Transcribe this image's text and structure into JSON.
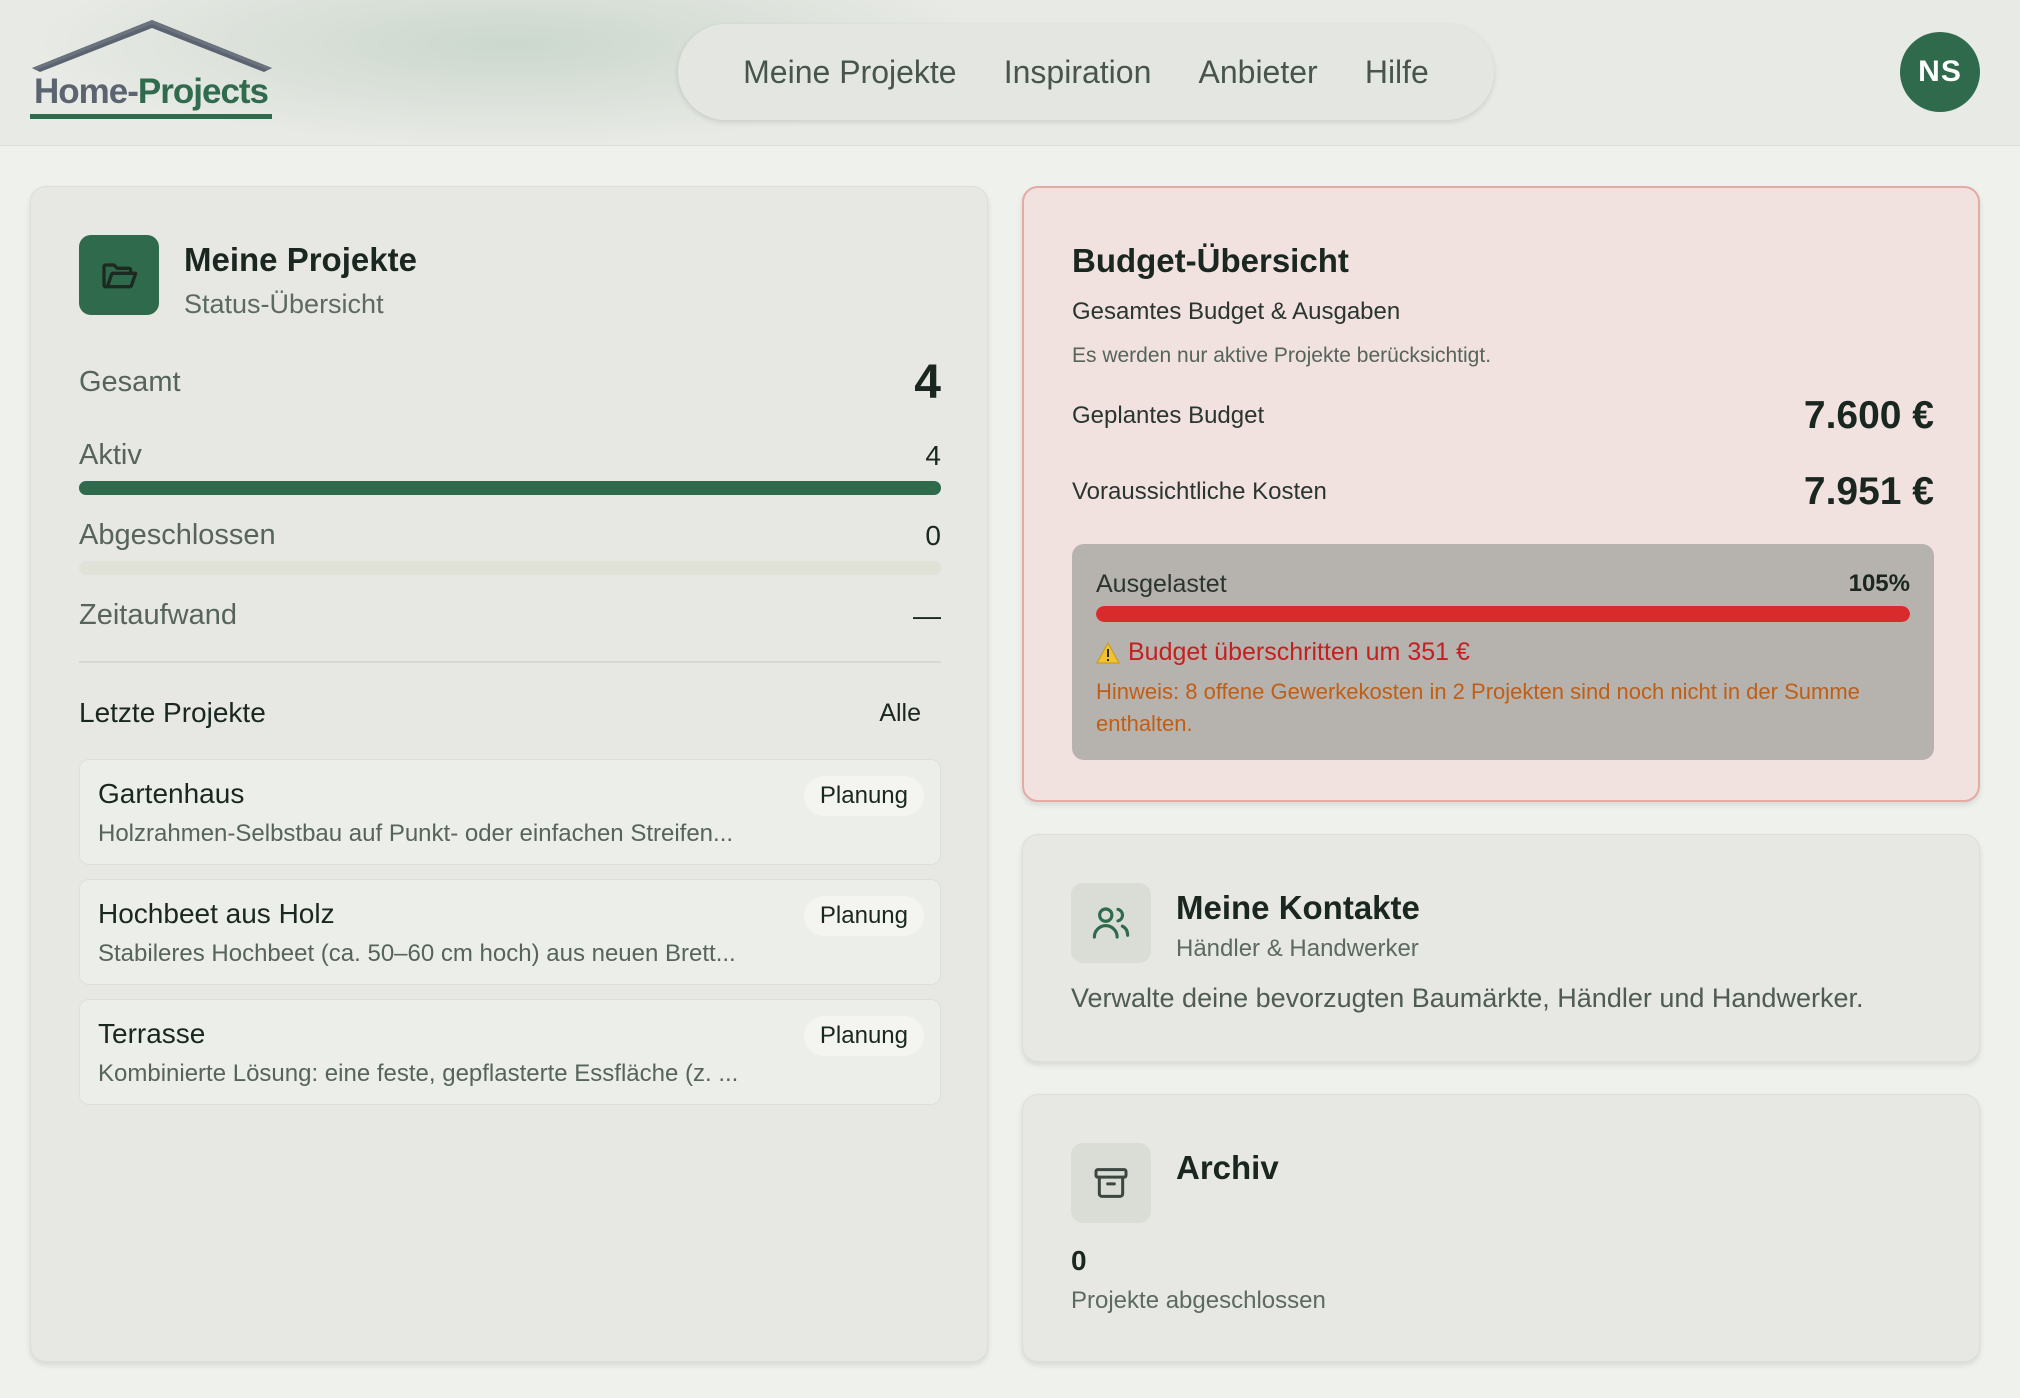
{
  "brand": {
    "name_part1": "Home-",
    "name_part2": "Projects"
  },
  "nav": [
    "Meine Projekte",
    "Inspiration",
    "Anbieter",
    "Hilfe"
  ],
  "user": {
    "initials": "NS"
  },
  "projects_card": {
    "title": "Meine Projekte",
    "subtitle": "Status-Übersicht",
    "stats": {
      "total_label": "Gesamt",
      "total_value": "4",
      "active_label": "Aktiv",
      "active_value": "4",
      "active_fraction": 1.0,
      "done_label": "Abgeschlossen",
      "done_value": "0",
      "done_fraction": 0.0,
      "time_label": "Zeitaufwand",
      "time_value": "—"
    },
    "recent_title": "Letzte Projekte",
    "all_link": "Alle",
    "recent": [
      {
        "name": "Gartenhaus",
        "desc": "Holzrahmen-Selbstbau auf Punkt- oder einfachen Streifen...",
        "status": "Planung"
      },
      {
        "name": "Hochbeet aus Holz",
        "desc": "Stabileres Hochbeet (ca. 50–60 cm hoch) aus neuen Brett...",
        "status": "Planung"
      },
      {
        "name": "Terrasse",
        "desc": "Kombinierte Lösung: eine feste, gepflasterte Essfläche (z. ...",
        "status": "Planung"
      }
    ]
  },
  "budget": {
    "title": "Budget-Übersicht",
    "subtitle": "Gesamtes Budget & Ausgaben",
    "note": "Es werden nur aktive Projekte berücksichtigt.",
    "planned_label": "Geplantes Budget",
    "planned_value": "7.600 €",
    "expected_label": "Voraussichtliche Kosten",
    "expected_value": "7.951 €",
    "usage_label": "Ausgelastet",
    "usage_pct": "105%",
    "usage_fraction": 1.05,
    "warning": "Budget überschritten um 351 €",
    "hint": "Hinweis: 8 offene Gewerkekosten in 2 Projekten sind noch nicht in der Summe enthalten.",
    "colors": {
      "danger": "#d92b2b",
      "hint": "#c25e14"
    }
  },
  "contacts": {
    "title": "Meine Kontakte",
    "subtitle": "Händler & Handwerker",
    "text": "Verwalte deine bevorzugten Baumärkte, Händler und Handwerker."
  },
  "archive": {
    "title": "Archiv",
    "count": "0",
    "count_label": "Projekte abgeschlossen"
  },
  "icons": {
    "projects": "folder-open-icon",
    "contacts": "users-icon",
    "archive": "archive-box-icon",
    "warning": "warning-triangle-icon"
  },
  "theme": {
    "accent": "#2e6a4b",
    "background": "#eff1ec"
  }
}
